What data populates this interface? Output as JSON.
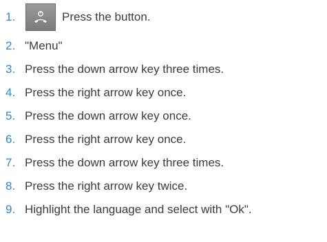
{
  "steps": [
    {
      "number": "1.",
      "text": "Press the button.",
      "icon": "power-end-call-icon"
    },
    {
      "number": "2.",
      "text": "\"Menu\""
    },
    {
      "number": "3.",
      "text": "Press the down arrow key three times."
    },
    {
      "number": "4.",
      "text": "Press the right arrow key once."
    },
    {
      "number": "5.",
      "text": "Press the down arrow key once."
    },
    {
      "number": "6.",
      "text": "Press the right arrow key once."
    },
    {
      "number": "7.",
      "text": "Press the down arrow key three times."
    },
    {
      "number": "8.",
      "text": "Press the right arrow key twice."
    },
    {
      "number": "9.",
      "text": "Highlight the language and select with \"Ok\"."
    }
  ],
  "colors": {
    "number": "#2f86d6",
    "text": "#3a3a3a",
    "button_bg": "#8a8a8a"
  }
}
